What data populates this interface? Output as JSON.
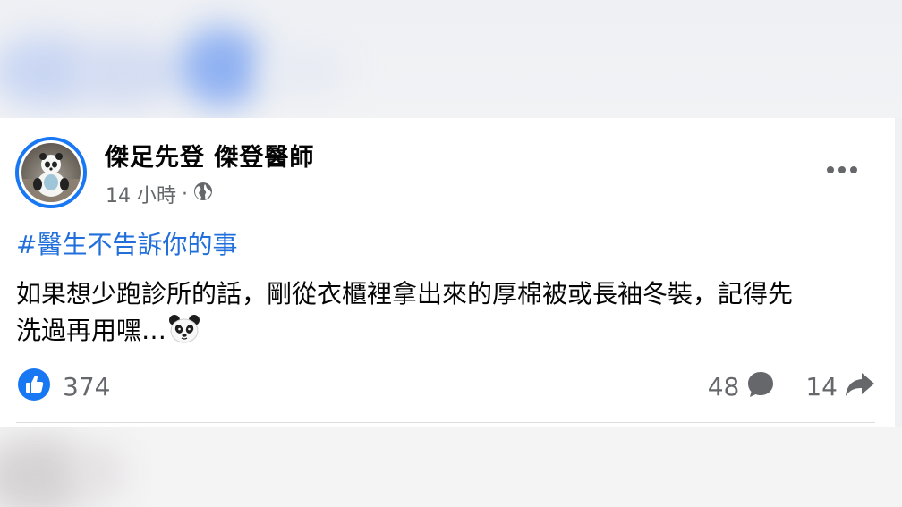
{
  "post": {
    "author_name": "傑足先登 傑登醫師",
    "time": "14 小時",
    "separator": "·",
    "hashtag": "#醫生不告訴你的事",
    "body_line1": "如果想少跑診所的話，剛從衣櫃裡拿出來的厚棉被或長袖冬裝，記得先",
    "body_line2": "洗過再用嘿…",
    "body_emoji": "panda-face",
    "privacy_icon": "globe-icon",
    "more_icon": "more-options-icon"
  },
  "stats": {
    "likes": "374",
    "comments": "48",
    "shares": "14"
  },
  "colors": {
    "accent": "#1877f2",
    "hashtag": "#216fdb",
    "secondary_text": "#65676b",
    "primary_text": "#050505"
  }
}
